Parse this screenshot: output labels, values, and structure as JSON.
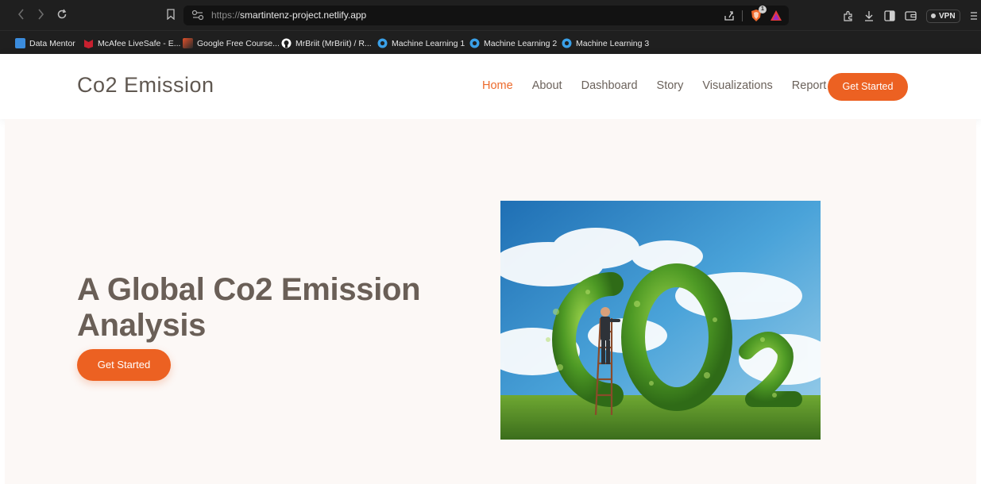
{
  "browser": {
    "url_protocol": "https://",
    "url_host": "smartintenz-project.netlify.app",
    "brave_badge": "1",
    "vpn_label": "VPN",
    "bookmarks": [
      {
        "label": "Data Mentor",
        "icon": "data-mentor-icon",
        "color": "#3b8cdd"
      },
      {
        "label": "McAfee LiveSafe - E...",
        "icon": "mcafee-icon",
        "color": "#c8202f"
      },
      {
        "label": "Google Free Course...",
        "icon": "google-course-icon",
        "color": "#e0502a"
      },
      {
        "label": "MrBriit (MrBriit) / R...",
        "icon": "github-icon",
        "color": "#ffffff"
      },
      {
        "label": "Machine Learning 1",
        "icon": "ml-icon",
        "color": "#3aa0e8"
      },
      {
        "label": "Machine Learning 2",
        "icon": "ml-icon",
        "color": "#3aa0e8"
      },
      {
        "label": "Machine Learning 3",
        "icon": "ml-icon",
        "color": "#3aa0e8"
      }
    ]
  },
  "site": {
    "brand": "Co2 Emission",
    "accent_color": "#ec6122",
    "nav": [
      {
        "label": "Home",
        "active": true
      },
      {
        "label": "About",
        "active": false
      },
      {
        "label": "Dashboard",
        "active": false
      },
      {
        "label": "Story",
        "active": false
      },
      {
        "label": "Visualizations",
        "active": false
      },
      {
        "label": "Report",
        "active": false
      }
    ],
    "header_cta": "Get Started"
  },
  "hero": {
    "title": "A Global Co2 Emission Analysis",
    "cta": "Get Started",
    "image": "co2-leaves-illustration"
  }
}
